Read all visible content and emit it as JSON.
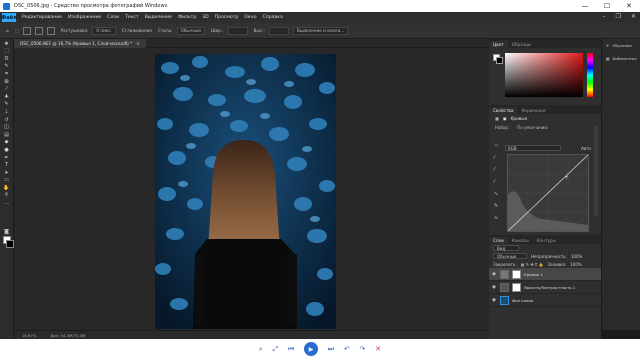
{
  "window": {
    "title": "DSC_0506.jpg - Средство просмотра фотографий Windows",
    "minimize": "—",
    "maximize": "☐",
    "close": "✕"
  },
  "ps": {
    "logo": "Файл"
  },
  "menu": [
    "Файл",
    "Редактирование",
    "Изображение",
    "Слои",
    "Текст",
    "Выделение",
    "Фильтр",
    "3D",
    "Просмотр",
    "Окно",
    "Справка"
  ],
  "options": {
    "size_label": "1",
    "feather_label": "Растушевка:",
    "feather_value": "0 пикс.",
    "smoothing": "Сглаживание",
    "style_label": "Стиль:",
    "style_value": "Обычный",
    "width_label": "Шир.:",
    "height_label": "Выс.:",
    "refine": "Выделение и маска..."
  },
  "document": {
    "tab": "DSC_0506.NEF @ 16,7% (Кривые 1, Слой-маска/8) *",
    "close": "×"
  },
  "status": {
    "zoom": "16,67%",
    "doc": "Док: 34,3M/70,3M"
  },
  "color_panel": {
    "tab_active": "Цвет",
    "tab_other": "Образцы"
  },
  "properties": {
    "tab_active": "Свойства",
    "tab_other": "Коррекция",
    "header": "Кривые",
    "preset_label": "Набор:",
    "preset_value": "По умолчанию",
    "channel": "RGB",
    "auto": "Авто"
  },
  "layers": {
    "tabs": [
      "Слои",
      "Каналы",
      "Контуры"
    ],
    "filter": "Вид",
    "blend": "Обычные",
    "opacity_label": "Непрозрачность:",
    "opacity_value": "100%",
    "lock_label": "Закрепить:",
    "fill_label": "Заливка:",
    "fill_value": "100%",
    "items": [
      {
        "name": "Кривые 1"
      },
      {
        "name": "Яркость/Контрастность 1"
      },
      {
        "name": "Фон копия"
      }
    ]
  },
  "dock": [
    {
      "label": "Обучение"
    },
    {
      "label": "Библиотеки"
    }
  ],
  "viewer": {
    "zoom": "⌕",
    "fit": "⤢",
    "prev": "⏮",
    "play": "▶",
    "next": "⏭",
    "rotl": "↶",
    "rotr": "↷",
    "del": "✕"
  }
}
